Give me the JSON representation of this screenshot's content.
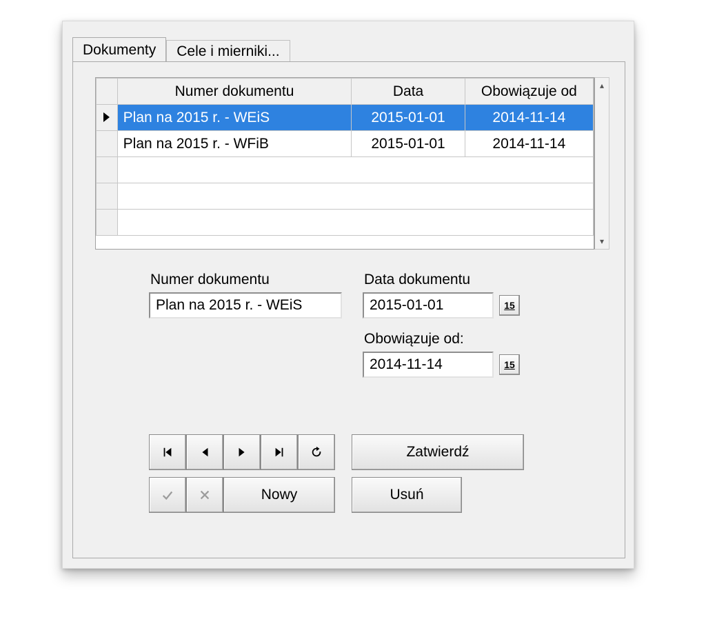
{
  "tabs": {
    "active": "Dokumenty",
    "inactive": "Cele i mierniki..."
  },
  "grid": {
    "headers": {
      "num": "Numer dokumentu",
      "date": "Data",
      "valid": "Obowiązuje od"
    },
    "rows": [
      {
        "num": "Plan na 2015 r. - WEiS",
        "date": "2015-01-01",
        "valid": "2014-11-14",
        "selected": true
      },
      {
        "num": "Plan na 2015 r. - WFiB",
        "date": "2015-01-01",
        "valid": "2014-11-14",
        "selected": false
      }
    ]
  },
  "form": {
    "num_label": "Numer dokumentu",
    "num_value": "Plan na 2015 r. - WEiS",
    "date_label": "Data dokumentu",
    "date_value": "2015-01-01",
    "valid_label": "Obowiązuje od:",
    "valid_value": "2014-11-14",
    "cal_glyph": "15"
  },
  "buttons": {
    "confirm": "Zatwierdź",
    "new": "Nowy",
    "delete": "Usuń"
  }
}
